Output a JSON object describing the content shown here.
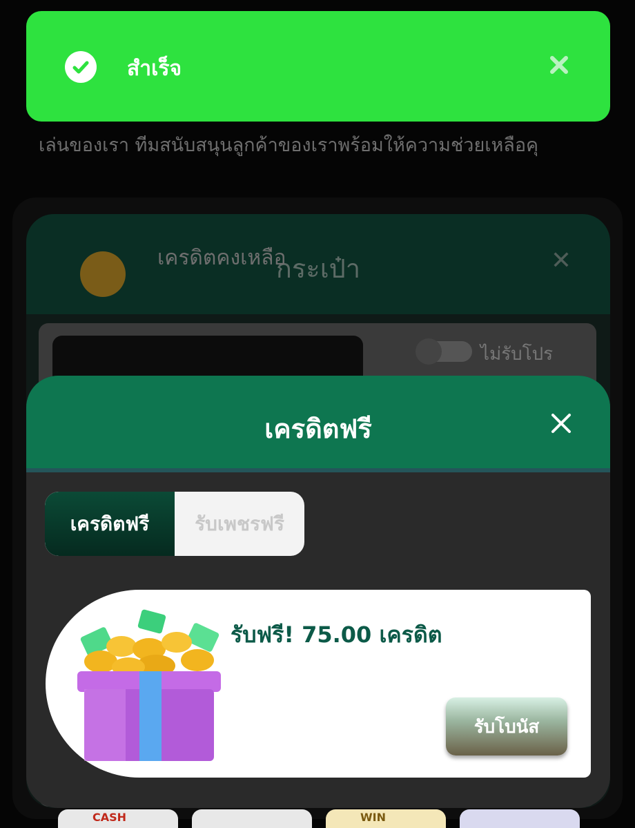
{
  "background": {
    "text": "ู่เล่นของเรา ทีมสนับสนุนลูกค้าของเราพร้อมให้ความช่วยเหลือคุ"
  },
  "wallet_modal": {
    "title": "กระเป๋า",
    "credit_label": "เครดิตคงเหลือ",
    "toggle_label": "ไม่รับโปร"
  },
  "toast": {
    "message": "สำเร็จ",
    "color": "#2ee23f"
  },
  "free_credit_modal": {
    "title": "เครดิตฟรี",
    "tabs": [
      {
        "label": "เครดิตฟรี",
        "active": true
      },
      {
        "label": "รับเพชรฟรี",
        "active": false
      }
    ],
    "bonus": {
      "text": "รับฟรี! 75.00 เครดิต",
      "button_label": "รับโบนัส"
    },
    "header_color": "#0e7650"
  },
  "thumbnails": [
    "CASH",
    "",
    "WIN",
    ""
  ]
}
